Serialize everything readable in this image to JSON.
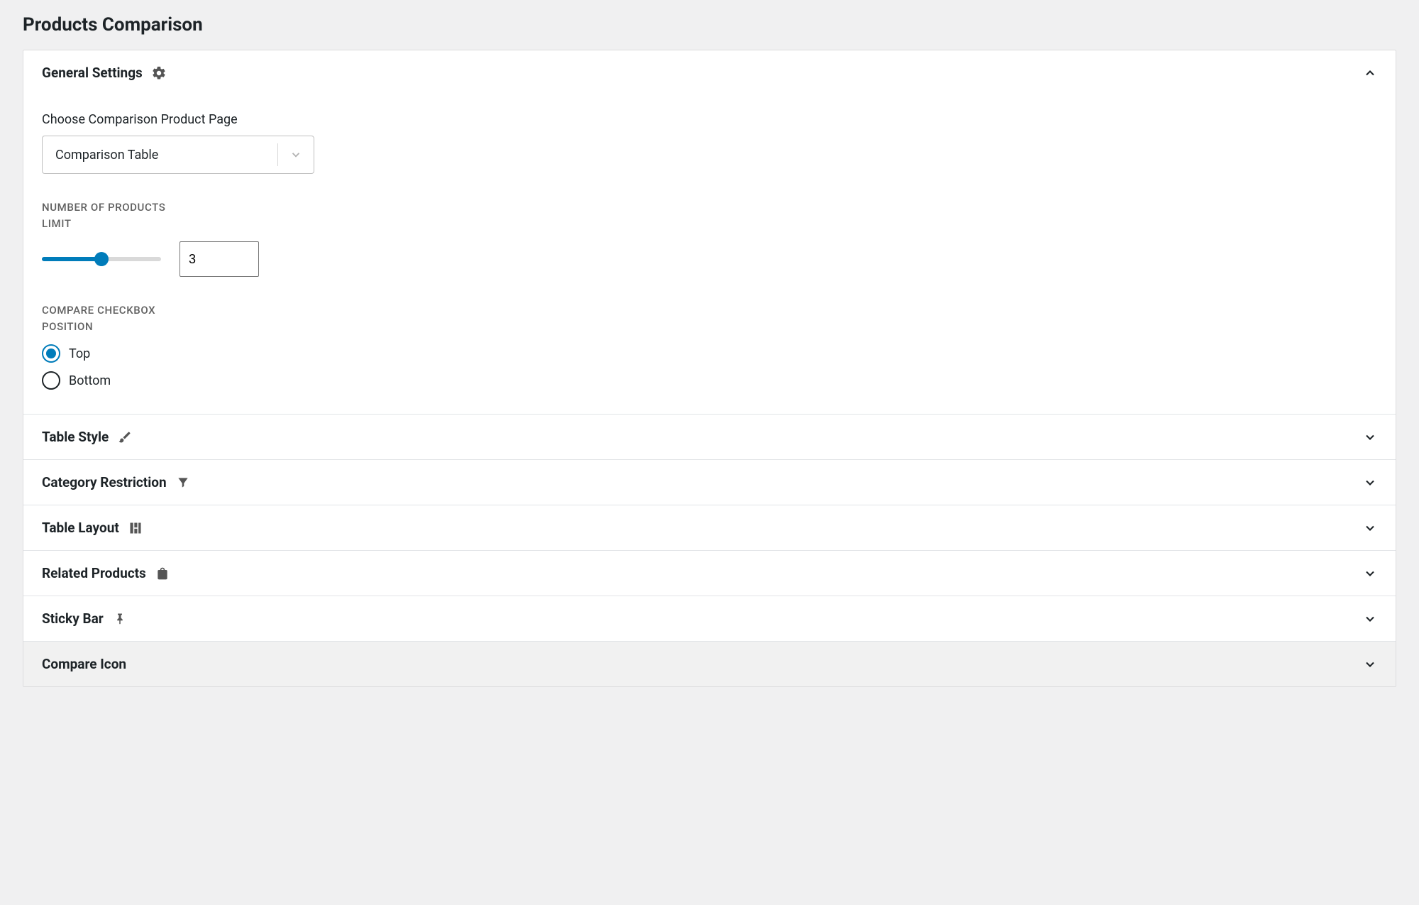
{
  "page_title": "Products Comparison",
  "sections": {
    "general": {
      "title": "General Settings",
      "icon": "gear-icon",
      "expanded": true,
      "fields": {
        "page_select": {
          "label": "Choose Comparison Product Page",
          "value": "Comparison Table"
        },
        "products_limit": {
          "label": "NUMBER OF PRODUCTS LIMIT",
          "value": "3",
          "slider_percent": 50
        },
        "checkbox_position": {
          "label": "COMPARE CHECKBOX POSITION",
          "options": [
            {
              "label": "Top",
              "selected": true
            },
            {
              "label": "Bottom",
              "selected": false
            }
          ]
        }
      }
    },
    "table_style": {
      "title": "Table Style",
      "icon": "brush-icon",
      "expanded": false
    },
    "category_restriction": {
      "title": "Category Restriction",
      "icon": "funnel-icon",
      "expanded": false
    },
    "table_layout": {
      "title": "Table Layout",
      "icon": "layout-icon",
      "expanded": false
    },
    "related_products": {
      "title": "Related Products",
      "icon": "bag-icon",
      "expanded": false
    },
    "sticky_bar": {
      "title": "Sticky Bar",
      "icon": "pin-icon",
      "expanded": false
    },
    "compare_icon": {
      "title": "Compare Icon",
      "icon": null,
      "expanded": false
    }
  }
}
